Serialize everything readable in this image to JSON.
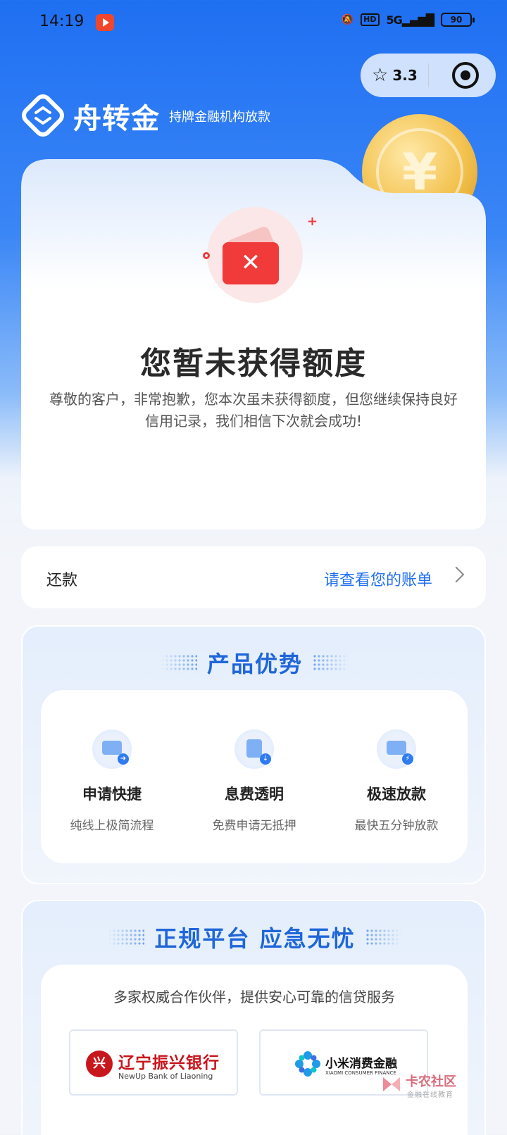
{
  "status_bar": {
    "time": "14:19",
    "hd": "HD",
    "network": "5G",
    "battery": "90"
  },
  "capsule": {
    "rating": "3.3",
    "star_icon": "star-outline-icon",
    "target_icon": "target-icon"
  },
  "brand": {
    "name": "舟转金",
    "tagline": "持牌金融机构放款",
    "logo_icon": "exchange-logo-icon",
    "coin_symbol": "¥"
  },
  "result": {
    "icon": "wallet-error-icon",
    "title": "您暂未获得额度",
    "description": "尊敬的客户，非常抱歉，您本次虽未获得额度，但您继续保持良好信用记录，我们相信下次就会成功!"
  },
  "repay": {
    "label": "还款",
    "link": "请查看您的账单"
  },
  "advantages": {
    "title": "产品优势",
    "items": [
      {
        "title": "申请快捷",
        "subtitle": "纯线上极简流程",
        "icon": "card-arrow-icon"
      },
      {
        "title": "息费透明",
        "subtitle": "免费申请无抵押",
        "icon": "document-download-icon"
      },
      {
        "title": "极速放款",
        "subtitle": "最快五分钟放款",
        "icon": "wallet-bolt-icon"
      }
    ]
  },
  "platform": {
    "title": "正规平台 应急无忧",
    "intro": "多家权威合作伙伴，提供安心可靠的信贷服务",
    "partners": [
      {
        "name": "辽宁振兴银行",
        "name_en": "NewUp Bank of Liaoning",
        "logo_char": "兴"
      },
      {
        "name": "小米消费金融",
        "name_en": "XIAOMI CONSUMER FINANCE"
      }
    ]
  },
  "watermark": {
    "text": "卡农社区",
    "sub": "金融在线教育"
  },
  "colors": {
    "primary": "#1f6ff2",
    "error": "#f13a3a",
    "bank_red": "#c8161d"
  }
}
